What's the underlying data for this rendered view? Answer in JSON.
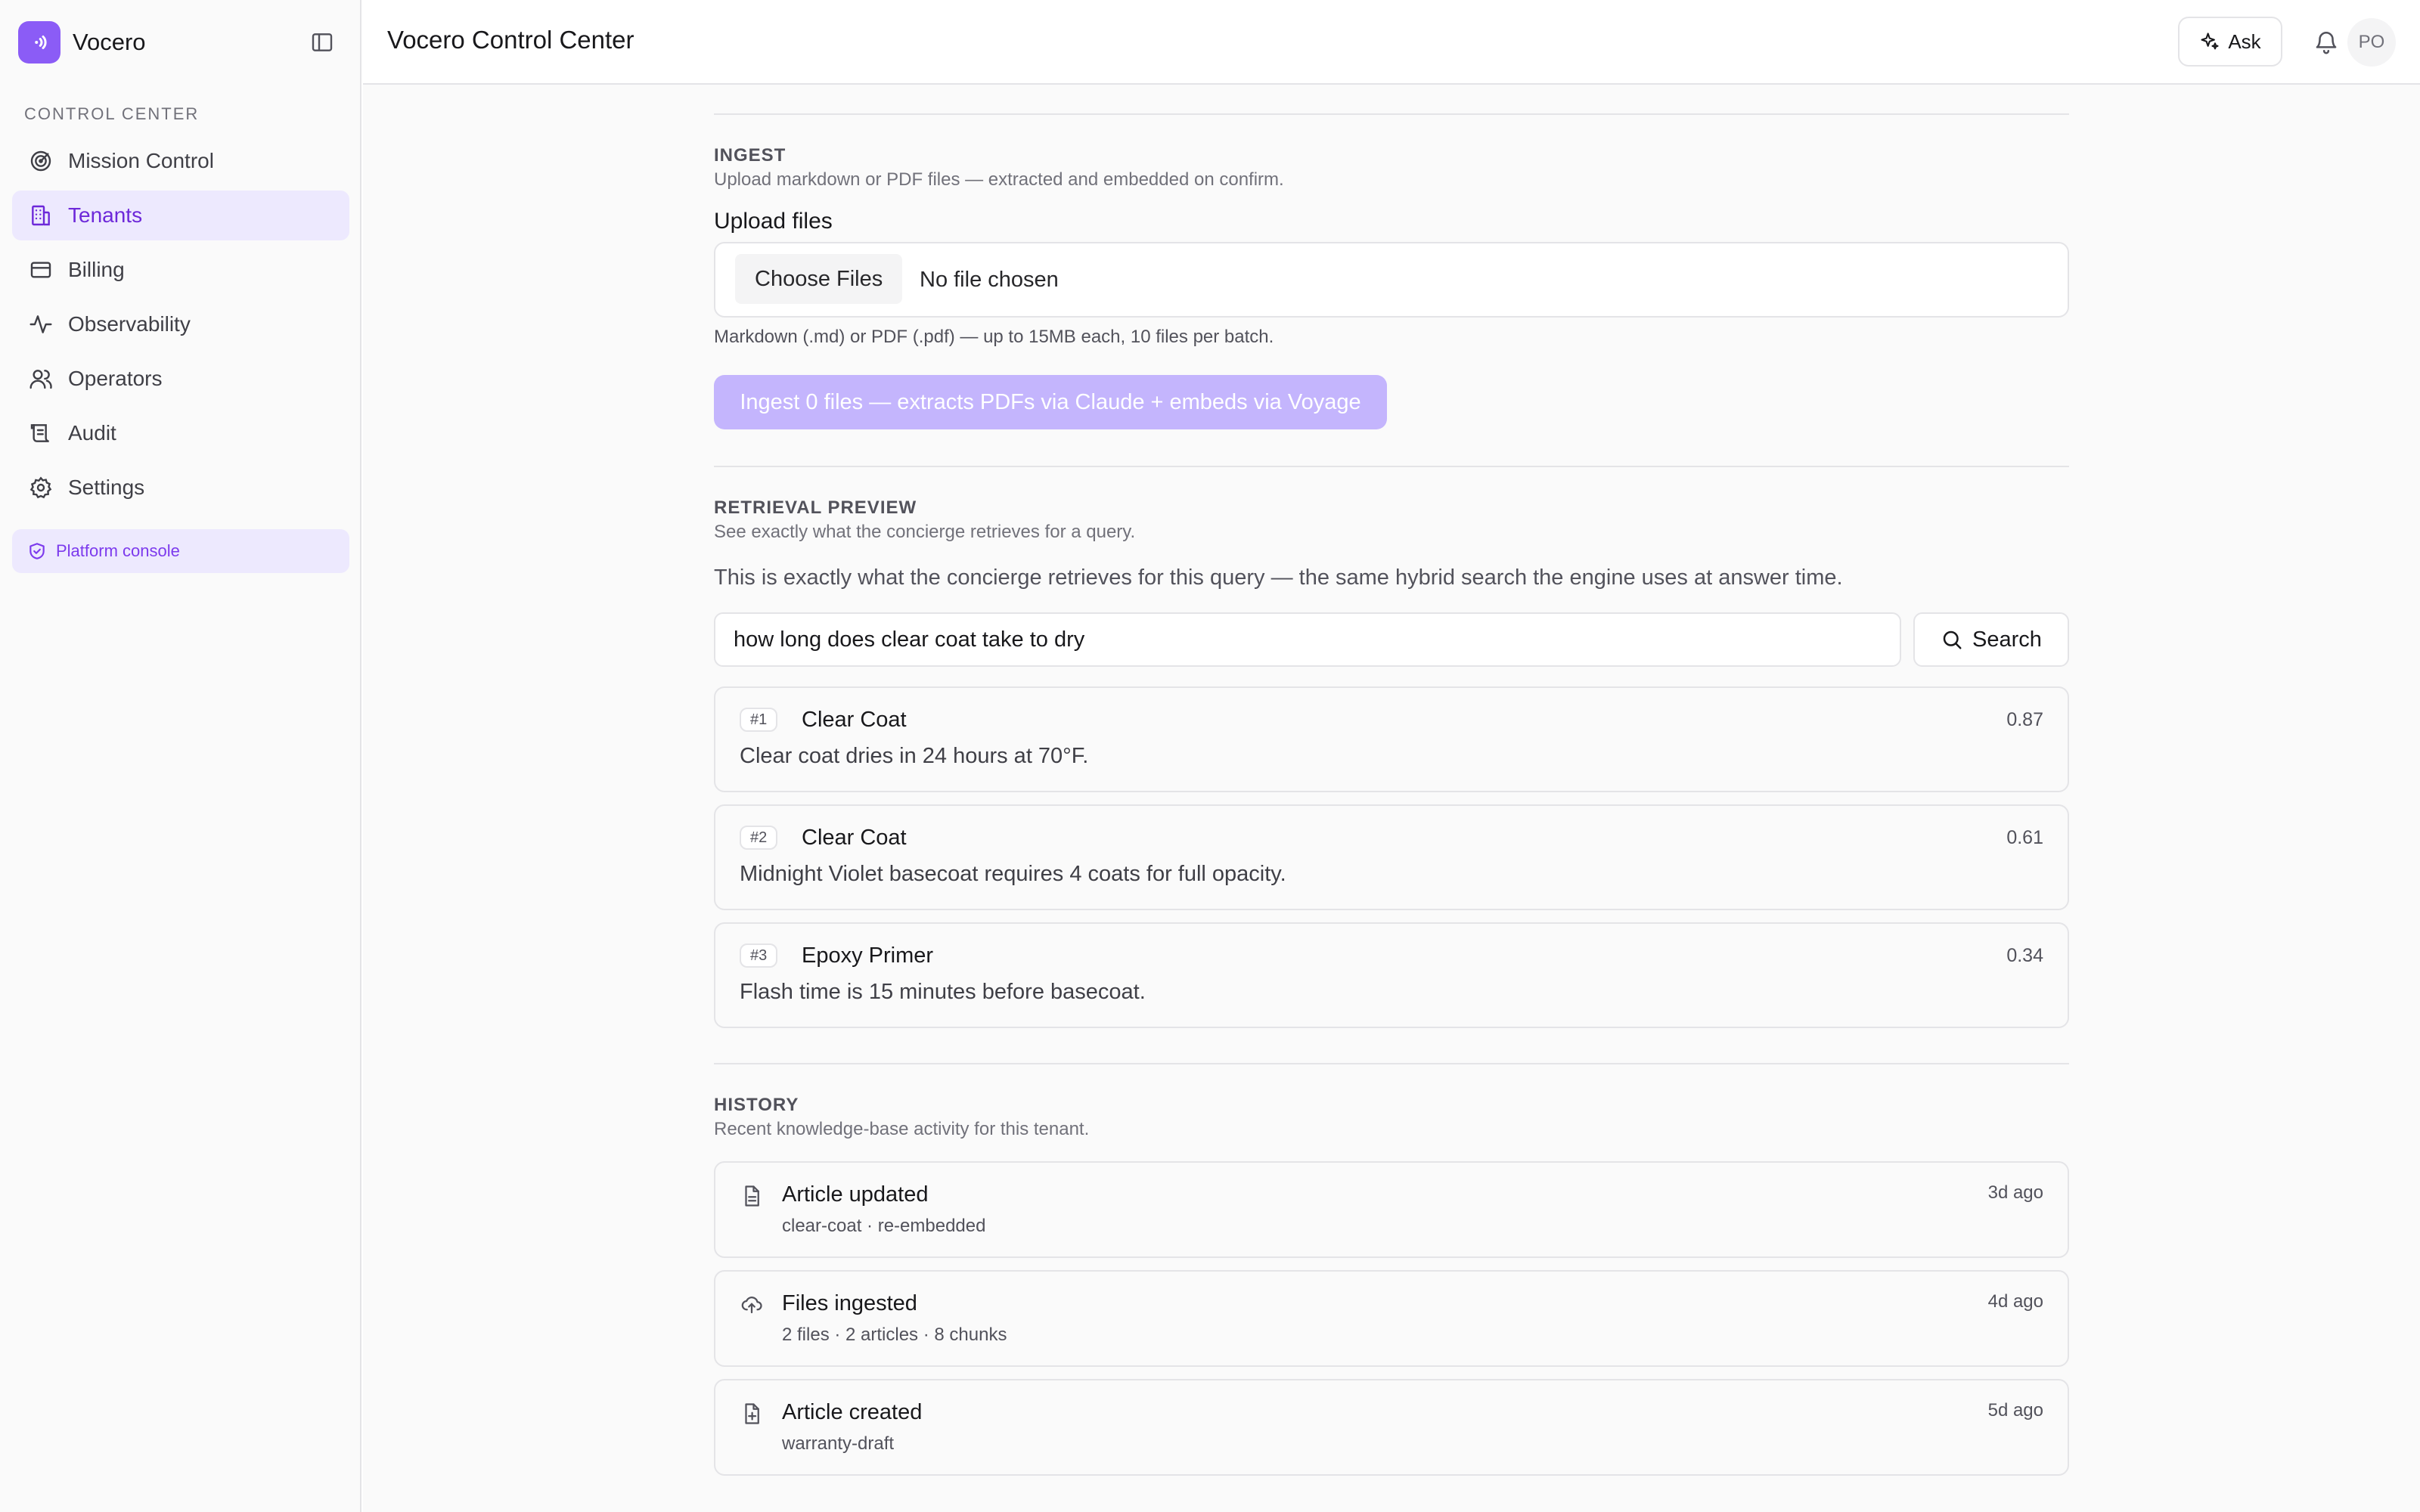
{
  "brand": {
    "name": "Vocero"
  },
  "sidebar": {
    "section_label": "CONTROL CENTER",
    "items": [
      {
        "label": "Mission Control",
        "icon": "radar-icon"
      },
      {
        "label": "Tenants",
        "icon": "building-icon",
        "active": true
      },
      {
        "label": "Billing",
        "icon": "credit-card-icon"
      },
      {
        "label": "Observability",
        "icon": "activity-icon"
      },
      {
        "label": "Operators",
        "icon": "users-icon"
      },
      {
        "label": "Audit",
        "icon": "scroll-icon"
      },
      {
        "label": "Settings",
        "icon": "gear-icon"
      }
    ],
    "platform_console": "Platform console"
  },
  "header": {
    "title": "Vocero Control Center",
    "ask_label": "Ask",
    "avatar_initials": "PO"
  },
  "ingest": {
    "title": "INGEST",
    "description": "Upload markdown or PDF files — extracted and embedded on confirm.",
    "upload_label": "Upload files",
    "choose_files": "Choose Files",
    "no_file": "No file chosen",
    "hint": "Markdown (.md) or PDF (.pdf) — up to 15MB each, 10 files per batch.",
    "button": "Ingest 0 files — extracts PDFs via Claude + embeds via Voyage"
  },
  "retrieval": {
    "title": "RETRIEVAL PREVIEW",
    "description": "See exactly what the concierge retrieves for a query.",
    "intro": "This is exactly what the concierge retrieves for this query — the same hybrid search the engine uses at answer time.",
    "query": "how long does clear coat take to dry",
    "search_label": "Search",
    "results": [
      {
        "rank": "#1",
        "title": "Clear Coat",
        "score": "0.87",
        "text": "Clear coat dries in 24 hours at 70°F."
      },
      {
        "rank": "#2",
        "title": "Clear Coat",
        "score": "0.61",
        "text": "Midnight Violet basecoat requires 4 coats for full opacity."
      },
      {
        "rank": "#3",
        "title": "Epoxy Primer",
        "score": "0.34",
        "text": "Flash time is 15 minutes before basecoat."
      }
    ]
  },
  "history": {
    "title": "HISTORY",
    "description": "Recent knowledge-base activity for this tenant.",
    "items": [
      {
        "icon": "document-icon",
        "title": "Article updated",
        "sub": "clear-coat · re-embedded",
        "time": "3d ago"
      },
      {
        "icon": "cloud-upload-icon",
        "title": "Files ingested",
        "sub": "2 files · 2 articles · 8 chunks",
        "time": "4d ago"
      },
      {
        "icon": "file-plus-icon",
        "title": "Article created",
        "sub": "warranty-draft",
        "time": "5d ago"
      }
    ]
  },
  "colors": {
    "accent": "#8b5cf6",
    "accent_soft": "#ede9fe",
    "accent_text": "#6d28d9",
    "disabled_button": "#c4b5fd"
  }
}
